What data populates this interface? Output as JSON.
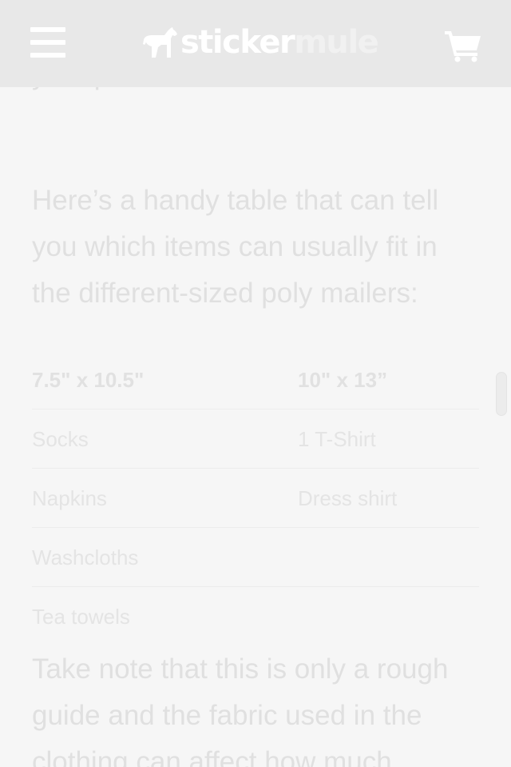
{
  "header": {
    "menu_icon": "hamburger-menu-icon",
    "logo": {
      "part1": "sticker",
      "part2": "mule",
      "icon": "goat-icon"
    },
    "cart_icon": "shopping-cart-icon",
    "colors": {
      "bar": "#e8e8e8",
      "icon": "#ffffff"
    }
  },
  "article": {
    "paragraph_1_fragment": "your product.",
    "paragraph_2": "Here’s a handy table that can tell you which items can usually fit in the different-sized poly mailers:",
    "table": {
      "headers": [
        "7.5\" x 10.5\"",
        "10\" x 13”"
      ],
      "rows": [
        [
          "Socks",
          "1 T-Shirt"
        ],
        [
          "Napkins",
          "Dress shirt"
        ],
        [
          "Washcloths",
          ""
        ],
        [
          "Tea towels",
          ""
        ]
      ]
    },
    "paragraph_3": "Take note that this is only a rough guide and the fabric used in the clothing can affect how much"
  }
}
